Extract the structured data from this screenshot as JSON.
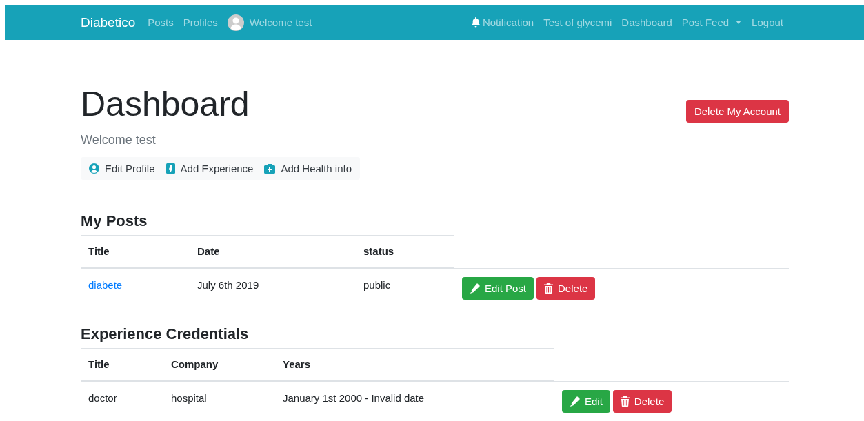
{
  "navbar": {
    "brand": "Diabetico",
    "links": [
      "Posts",
      "Profiles"
    ],
    "user": "Welcome test",
    "right_links": [
      {
        "kind": "bell",
        "label": "Notification"
      },
      {
        "kind": "plain",
        "label": "Test of glycemi"
      },
      {
        "kind": "plain",
        "label": "Dashboard"
      },
      {
        "kind": "dropdown",
        "label": "Post Feed"
      },
      {
        "kind": "plain",
        "label": "Logout"
      }
    ]
  },
  "delete_account_button": "Delete My Account",
  "title": "Dashboard",
  "subtitle": "Welcome test",
  "actions": [
    {
      "kind": "profile",
      "label": "Edit Profile"
    },
    {
      "kind": "experience",
      "label": "Add Experience"
    },
    {
      "kind": "health",
      "label": "Add Health info"
    }
  ],
  "sections": [
    {
      "heading": "My Posts",
      "columns": [
        "Title",
        "Date",
        "status"
      ],
      "rows": [
        {
          "cells": [
            {
              "text": "diabete",
              "link": true
            },
            {
              "text": "July 6th 2019",
              "link": false
            },
            {
              "text": "public",
              "link": false
            }
          ],
          "buttons": [
            {
              "kind": "edit",
              "label": "Edit Post"
            },
            {
              "kind": "delete",
              "label": "Delete"
            }
          ]
        }
      ]
    },
    {
      "heading": "Experience Credentials",
      "columns": [
        "Title",
        "Company",
        "Years"
      ],
      "rows": [
        {
          "cells": [
            {
              "text": "doctor",
              "link": false
            },
            {
              "text": "hospital",
              "link": false
            },
            {
              "text": "January 1st 2000 - Invalid date",
              "link": false
            }
          ],
          "buttons": [
            {
              "kind": "edit",
              "label": "Edit"
            },
            {
              "kind": "delete",
              "label": "Delete"
            }
          ]
        }
      ]
    }
  ]
}
